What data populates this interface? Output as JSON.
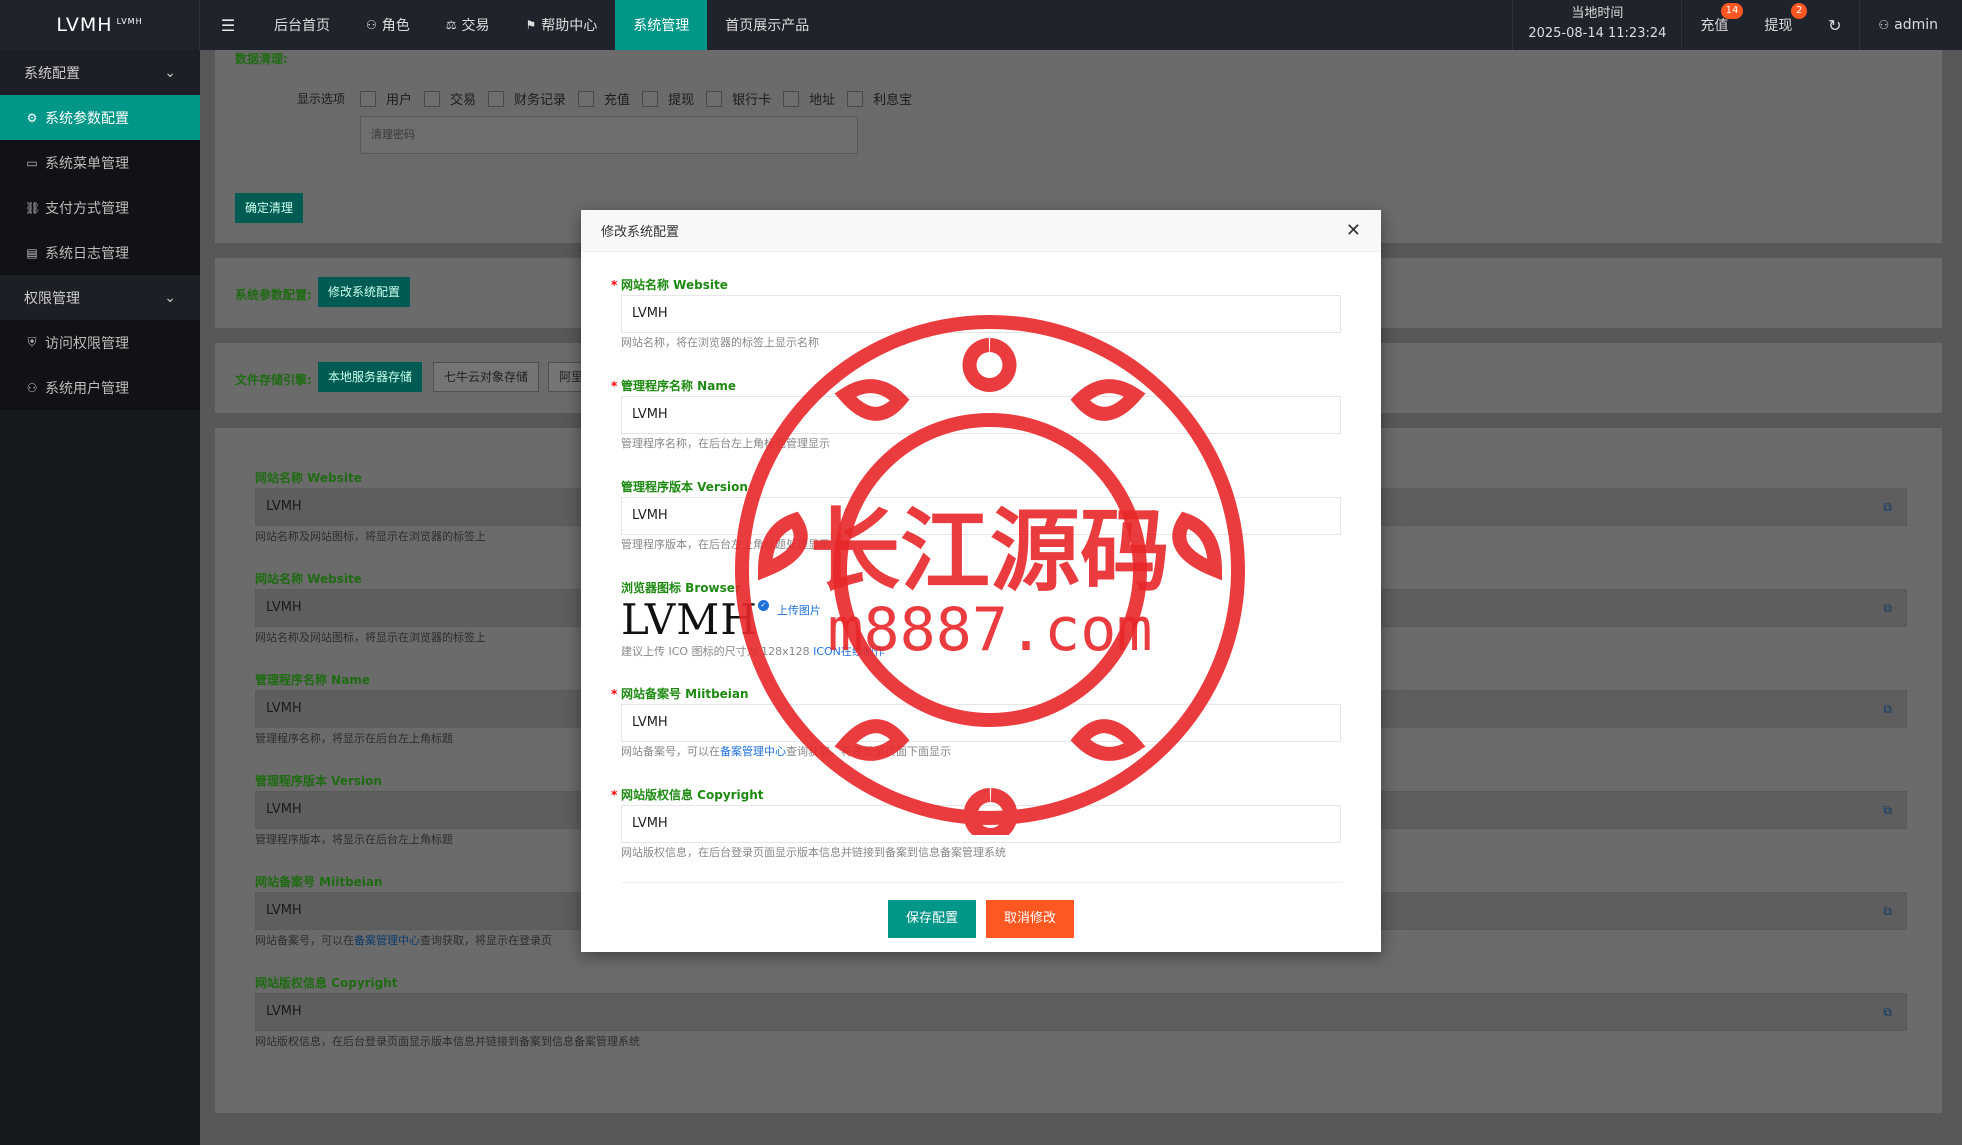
{
  "topbar": {
    "logo": "LVMH",
    "logo_sup": "LVMH",
    "nav": [
      {
        "label": "后台首页",
        "icon": ""
      },
      {
        "label": "角色",
        "icon": "user-icon"
      },
      {
        "label": "交易",
        "icon": "scale-icon"
      },
      {
        "label": "帮助中心",
        "icon": "flag-icon"
      },
      {
        "label": "系统管理",
        "icon": "",
        "active": true
      },
      {
        "label": "首页展示产品",
        "icon": ""
      }
    ],
    "time_label": "当地时间",
    "time_value": "2025-08-14 11:23:24",
    "recharge": "充值",
    "recharge_badge": "14",
    "withdraw": "提现",
    "withdraw_badge": "2",
    "user": "admin"
  },
  "sidebar": {
    "group1": "系统配置",
    "items1": [
      "系统参数配置",
      "系统菜单管理",
      "支付方式管理",
      "系统日志管理"
    ],
    "group2": "权限管理",
    "items2": [
      "访问权限管理",
      "系统用户管理"
    ]
  },
  "cleanup": {
    "title": "数据清理:",
    "display_label": "显示选项",
    "options": [
      "用户",
      "交易",
      "财务记录",
      "充值",
      "提现",
      "银行卡",
      "地址",
      "利息宝"
    ],
    "password_placeholder": "清理密码",
    "confirm": "确定清理"
  },
  "sysparam": {
    "label": "系统参数配置:",
    "button": "修改系统配置"
  },
  "storage": {
    "label": "文件存储引擎:",
    "options": [
      "本地服务器存储",
      "七牛云对象存储",
      "阿里"
    ]
  },
  "form": [
    {
      "label": "网站名称 Website",
      "value": "LVMH",
      "hint": "网站名称及网站图标，将显示在浏览器的标签上"
    },
    {
      "label": "网站名称 Website",
      "value": "LVMH",
      "hint": "网站名称及网站图标，将显示在浏览器的标签上"
    },
    {
      "label": "管理程序名称 Name",
      "value": "LVMH",
      "hint": "管理程序名称，将显示在后台左上角标题"
    },
    {
      "label": "管理程序版本 Version",
      "value": "LVMH",
      "hint": "管理程序版本，将显示在后台左上角标题"
    },
    {
      "label": "网站备案号 Miitbeian",
      "value": "LVMH",
      "hint_pre": "网站备案号，可以在",
      "hint_link": "备案管理中心",
      "hint_post": "查询获取，将显示在登录页"
    },
    {
      "label": "网站版权信息 Copyright",
      "value": "LVMH",
      "hint": "网站版权信息，在后台登录页面显示版本信息并链接到备案到信息备案管理系统"
    }
  ],
  "dialog": {
    "title": "修改系统配置",
    "website_label": "网站名称 Website",
    "website_value": "LVMH",
    "website_hint": "网站名称，将在浏览器的标签上显示名称",
    "name_label": "管理程序名称 Name",
    "name_value": "LVMH",
    "name_hint": "管理程序名称，在后台左上角标题管理显示",
    "version_label": "管理程序版本 Version",
    "version_value": "LVMH",
    "version_hint": "管理程序版本，在后台左上角标题处理显示",
    "browser_label": "浏览器图标 Browser",
    "browser_logo": "LVMH",
    "upload": "上传图片",
    "browser_hint_pre": "建议上传 ICO 图标的尺寸为 128x128",
    "browser_hint_link": "ICON在线制作",
    "miit_label": "网站备案号 Miitbeian",
    "miit_value": "LVMH",
    "miit_hint_pre": "网站备案号，可以在",
    "miit_hint_link": "备案管理中心",
    "miit_hint_post": "查询获取，将在登录页面下面显示",
    "copyright_label": "网站版权信息 Copyright",
    "copyright_value": "LVMH",
    "copyright_hint": "网站版权信息，在后台登录页面显示版本信息并链接到备案到信息备案管理系统",
    "save": "保存配置",
    "cancel": "取消修改"
  },
  "watermark": {
    "line1": "长江源码",
    "line2": "m8887.com"
  },
  "colors": {
    "accent": "#009688",
    "save": "#009688",
    "cancel": "#ff5722",
    "stamp": "#e8282b",
    "label_green": "#1e8a12"
  }
}
